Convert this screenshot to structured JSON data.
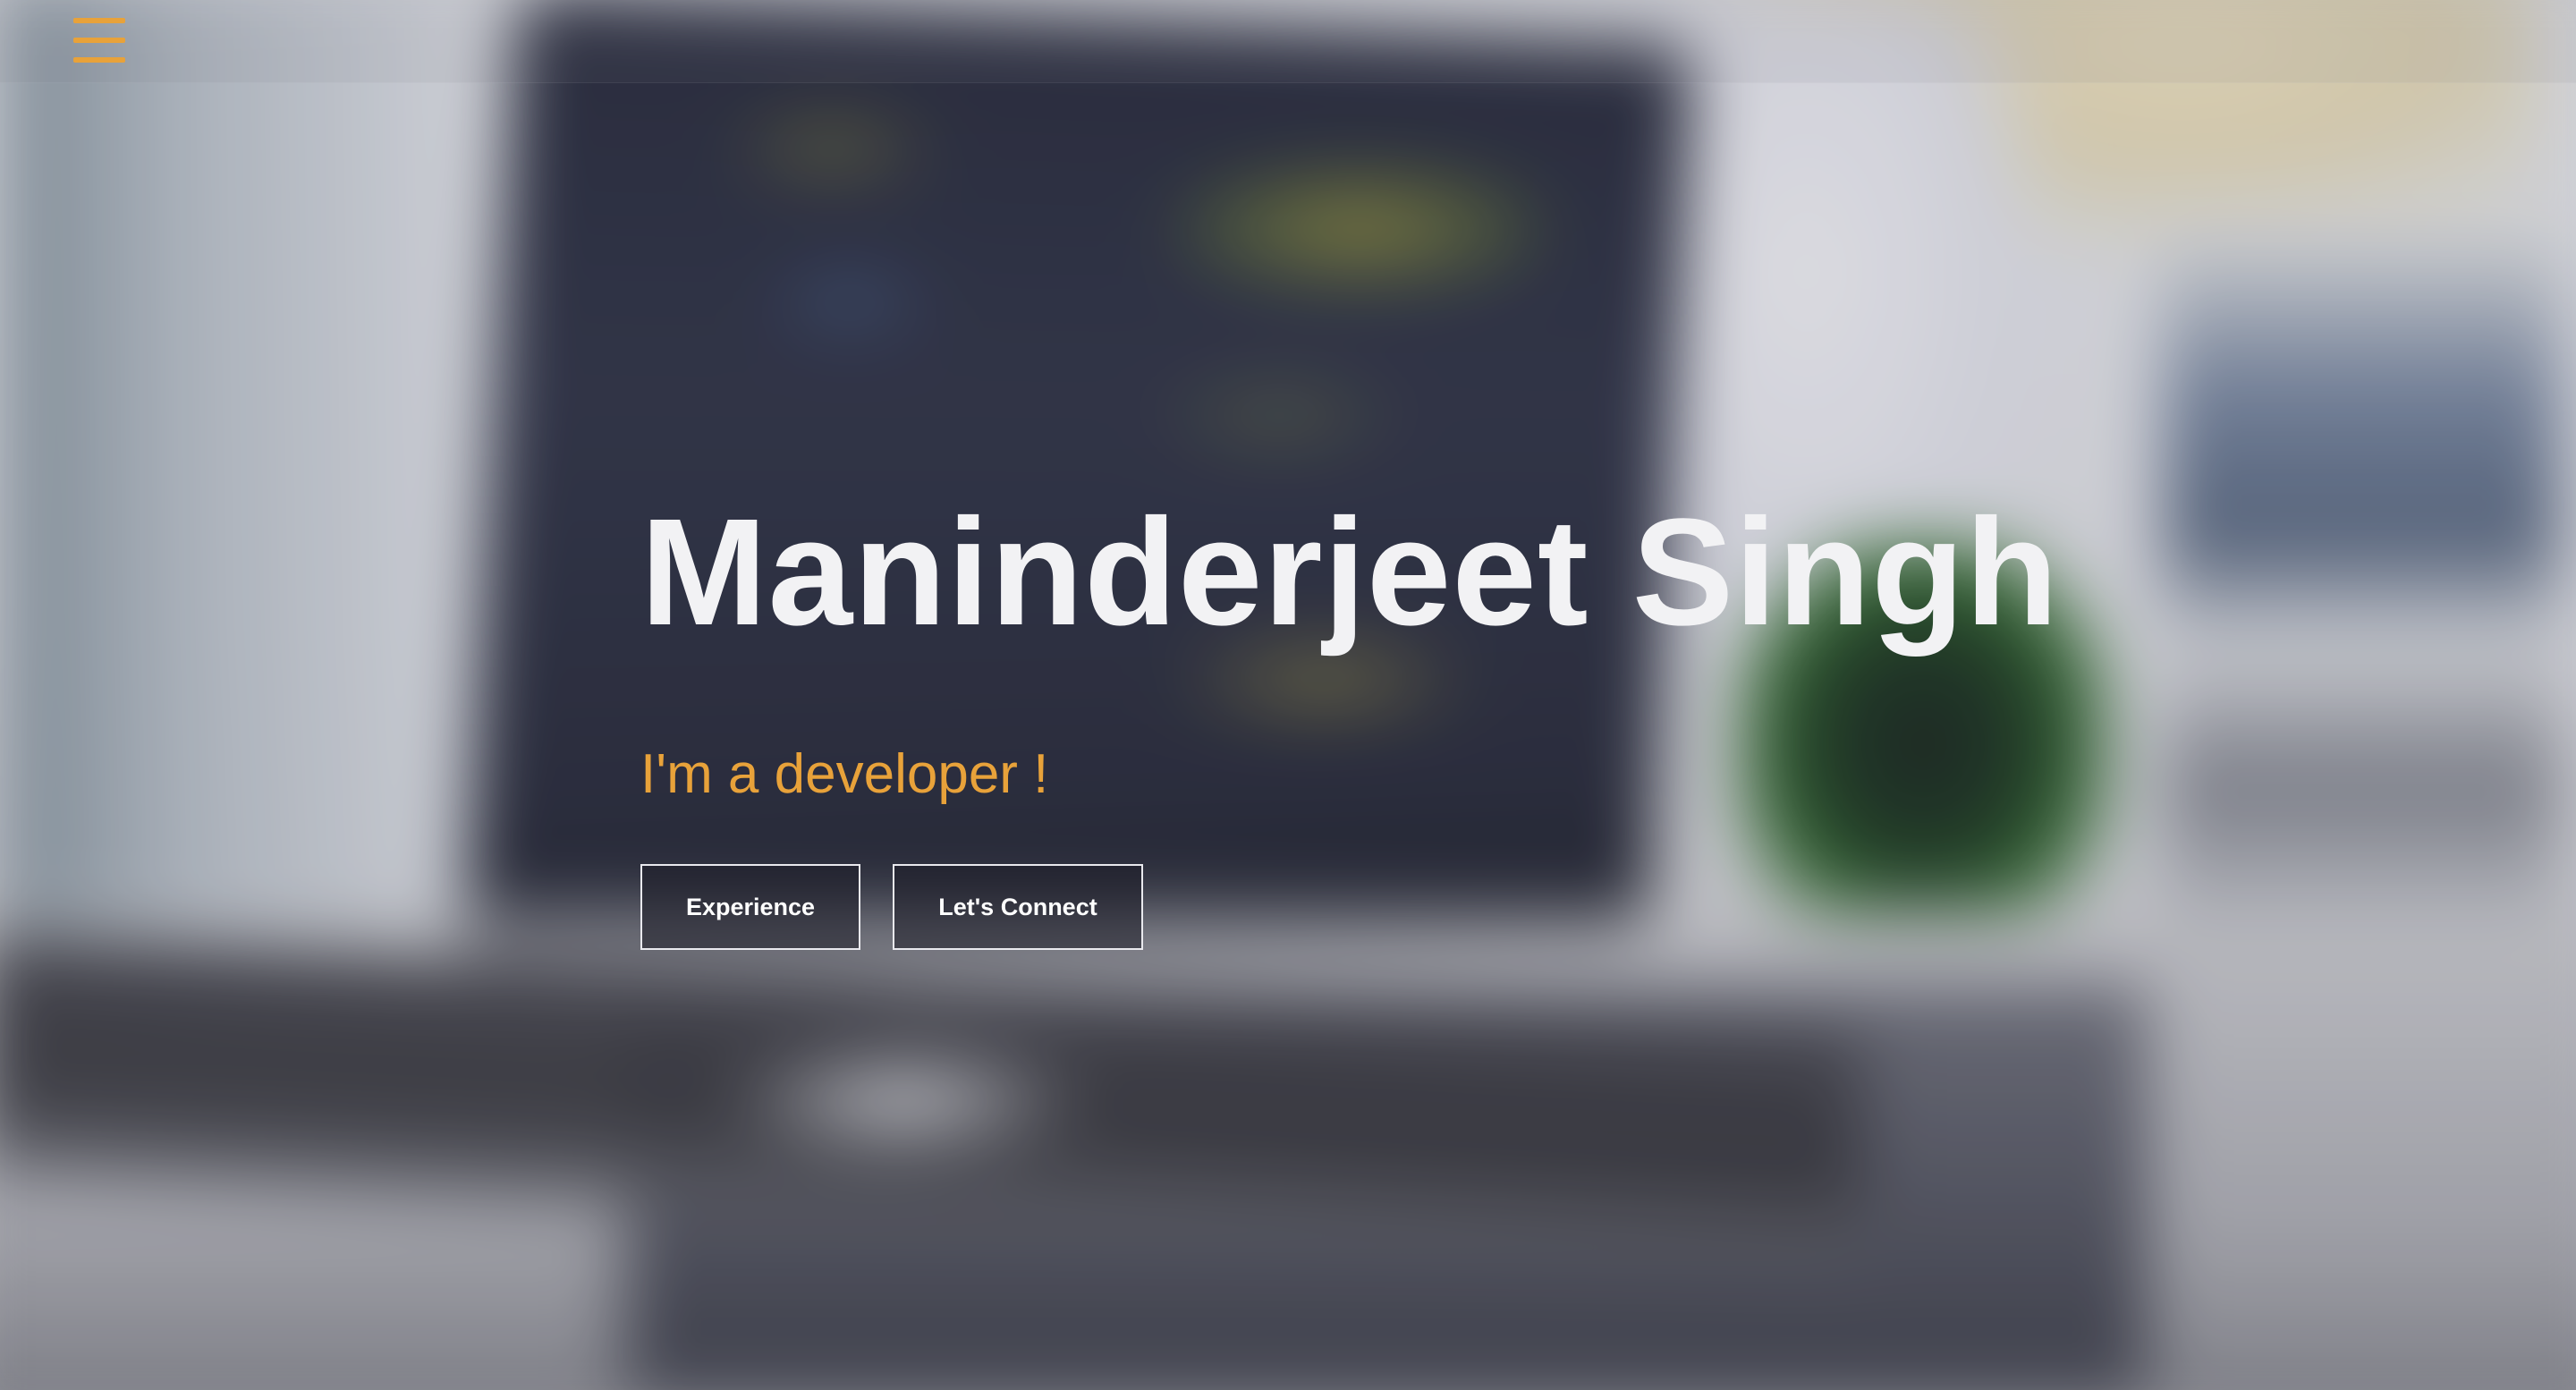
{
  "navbar": {
    "menu_icon": "hamburger-menu-icon",
    "accent_color": "#e8a23a"
  },
  "hero": {
    "name": "Maninderjeet Singh",
    "tagline": "I'm a developer !",
    "buttons": {
      "experience_label": "Experience",
      "connect_label": "Let's Connect"
    }
  },
  "theme": {
    "title_color": "#f2f2f4",
    "accent_color": "#e8a23a",
    "button_border_color": "#e9e9ee"
  }
}
